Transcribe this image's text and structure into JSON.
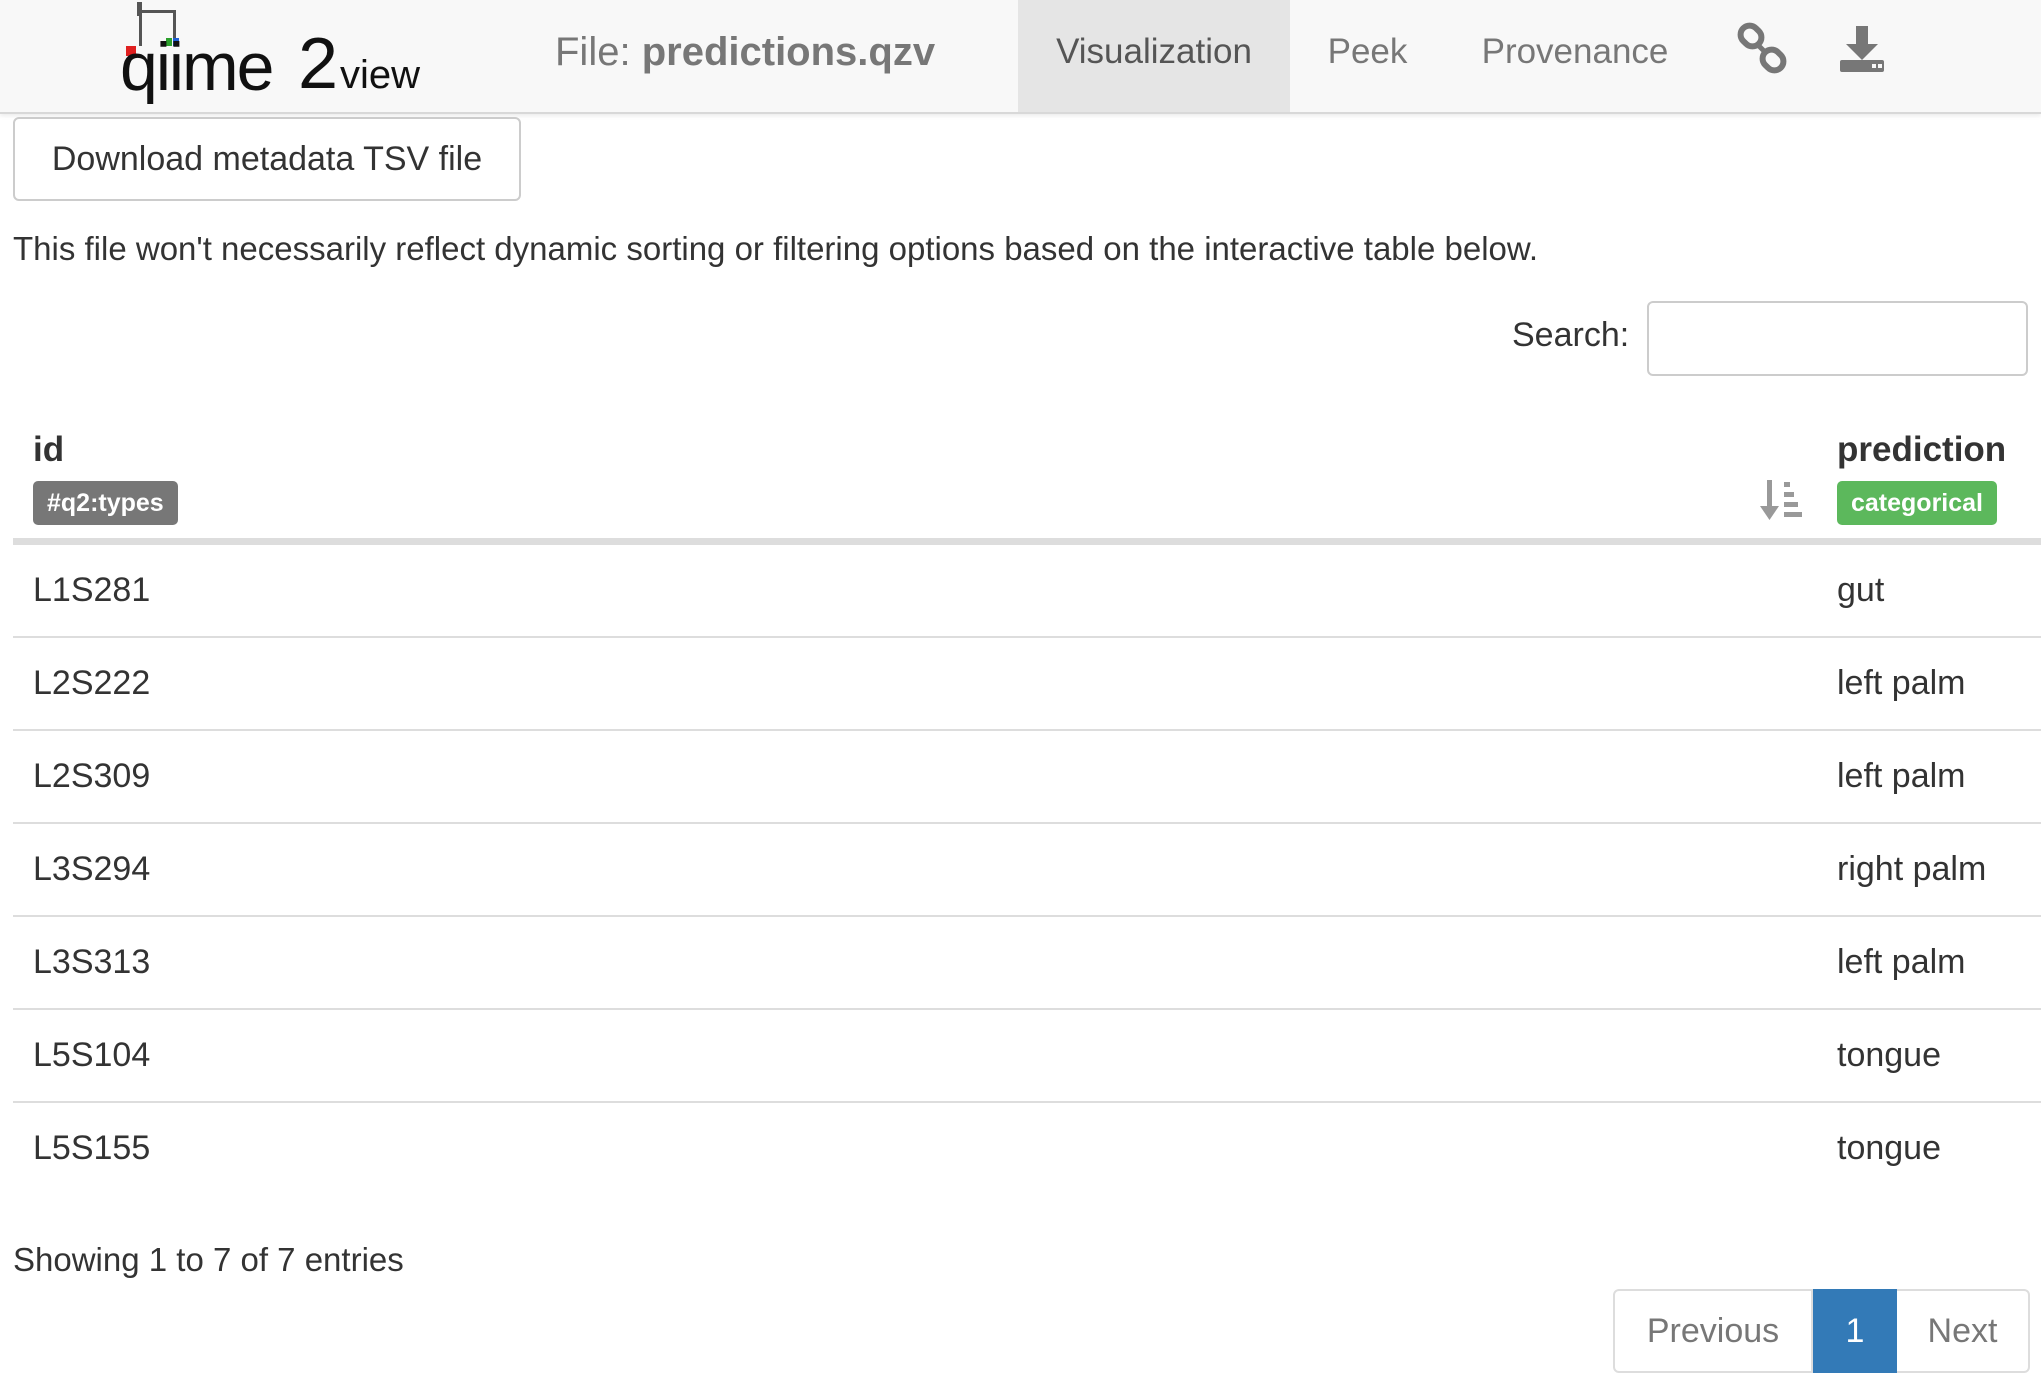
{
  "app": {
    "logo_text": "qiime2view",
    "file_prefix": "File:",
    "file_name": "predictions.qzv"
  },
  "nav": {
    "tabs": [
      {
        "label": "Visualization",
        "active": true
      },
      {
        "label": "Peek",
        "active": false
      },
      {
        "label": "Provenance",
        "active": false
      }
    ],
    "icons": [
      "link-icon",
      "download-icon"
    ]
  },
  "download": {
    "button_label": "Download metadata TSV file",
    "note": "This file won't necessarily reflect dynamic sorting or filtering options based on the interactive table below."
  },
  "search": {
    "label": "Search:",
    "value": "",
    "placeholder": ""
  },
  "table": {
    "columns": [
      {
        "title": "id",
        "type_badge": "#q2:types",
        "badge_color": "#777777"
      },
      {
        "title": "prediction",
        "type_badge": "categorical",
        "badge_color": "#5cb85c"
      }
    ],
    "sort_icon": "sort-amount-down-icon",
    "rows": [
      {
        "id": "L1S281",
        "prediction": "gut"
      },
      {
        "id": "L2S222",
        "prediction": "left palm"
      },
      {
        "id": "L2S309",
        "prediction": "left palm"
      },
      {
        "id": "L3S294",
        "prediction": "right palm"
      },
      {
        "id": "L3S313",
        "prediction": "left palm"
      },
      {
        "id": "L5S104",
        "prediction": "tongue"
      },
      {
        "id": "L5S155",
        "prediction": "tongue"
      }
    ]
  },
  "info": "Showing 1 to 7 of 7 entries",
  "pagination": {
    "previous": "Previous",
    "current": "1",
    "next": "Next"
  },
  "colors": {
    "navbar_bg": "#f8f8f8",
    "active_tab_bg": "#e5e5e5",
    "accent": "#337ab7",
    "categorical_badge": "#5cb85c",
    "types_badge": "#777777"
  }
}
